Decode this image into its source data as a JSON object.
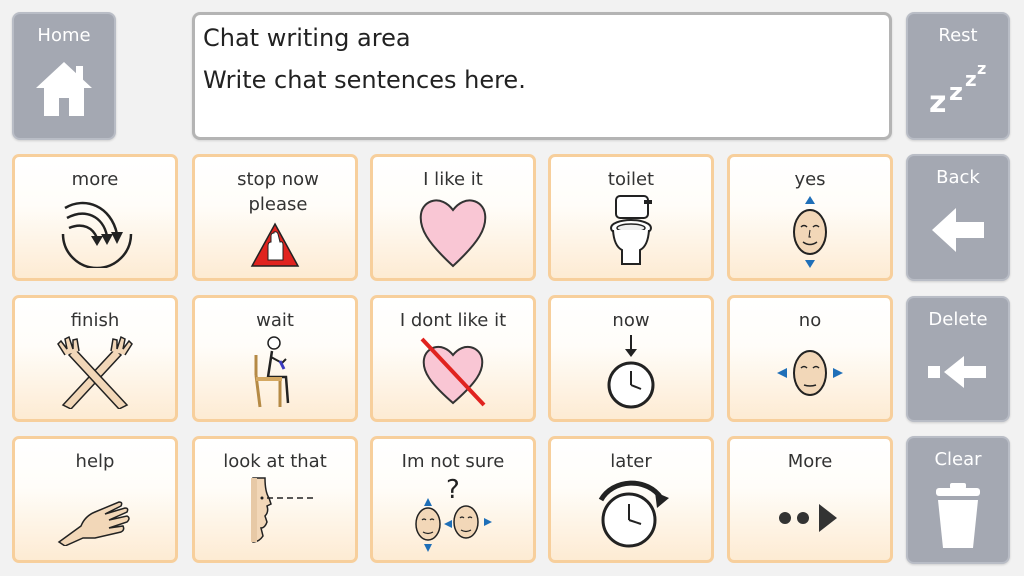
{
  "side": {
    "home": "Home",
    "rest": "Rest",
    "back": "Back",
    "delete": "Delete",
    "clear": "Clear"
  },
  "chat": {
    "title": "Chat writing area",
    "text": "Write chat sentences here."
  },
  "tiles": [
    {
      "label": "more",
      "icon": "more-arrows-icon"
    },
    {
      "label": "stop now please",
      "icon": "stop-hand-icon"
    },
    {
      "label": "I like it",
      "icon": "heart-icon"
    },
    {
      "label": "toilet",
      "icon": "toilet-icon"
    },
    {
      "label": "yes",
      "icon": "nodding-face-icon"
    },
    {
      "label": "finish",
      "icon": "crossed-hands-icon"
    },
    {
      "label": "wait",
      "icon": "sitting-person-icon"
    },
    {
      "label": "I dont like it",
      "icon": "crossed-heart-icon"
    },
    {
      "label": "now",
      "icon": "clock-pointer-icon"
    },
    {
      "label": "no",
      "icon": "head-shake-icon"
    },
    {
      "label": "help",
      "icon": "helping-hand-icon"
    },
    {
      "label": "look at that",
      "icon": "looking-face-icon"
    },
    {
      "label": "Im not sure",
      "icon": "unsure-faces-icon"
    },
    {
      "label": "later",
      "icon": "clock-arrow-icon"
    },
    {
      "label": "More",
      "icon": "next-dots-icon"
    }
  ],
  "colors": {
    "side_button": "#a4a8b2",
    "tile_border": "#f7cf9c",
    "tile_fill_bottom": "#fdebd3",
    "heart_pink": "#f9c6d4",
    "cross_red": "#e0231f"
  }
}
